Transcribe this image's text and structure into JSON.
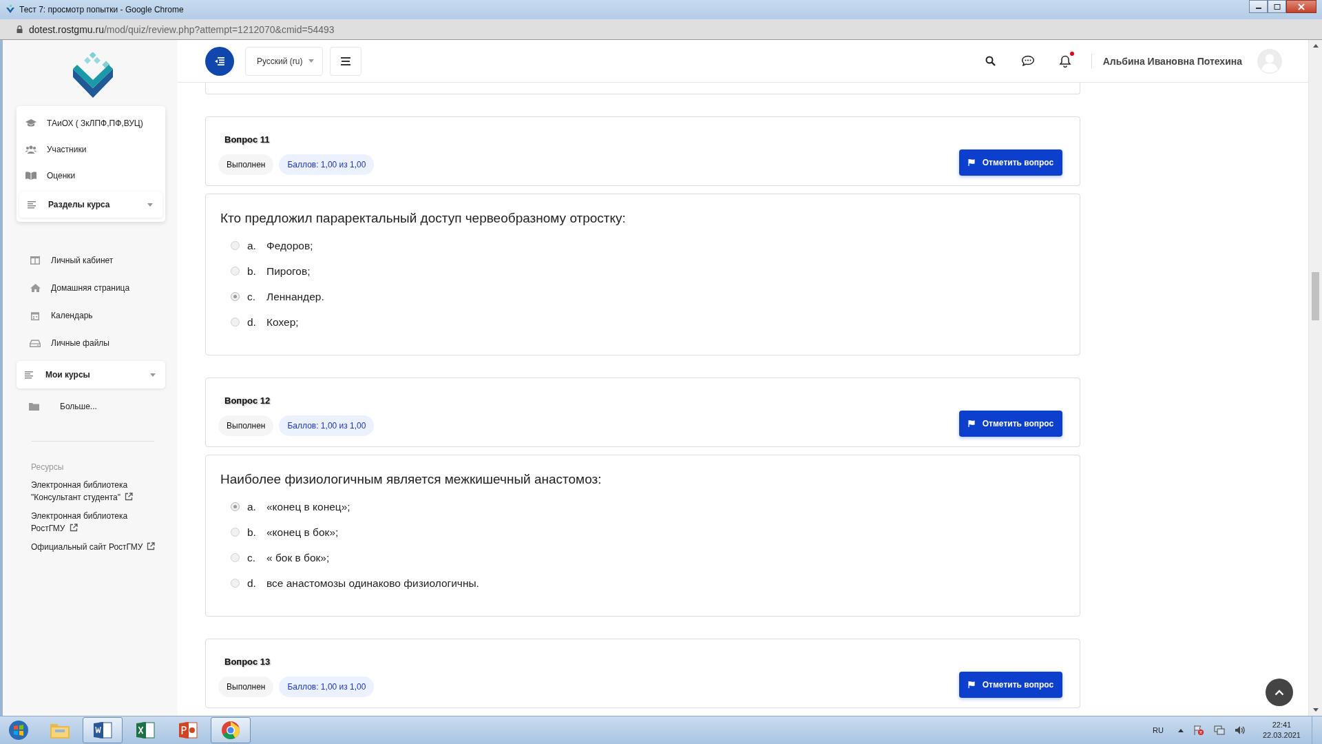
{
  "window": {
    "title": "Тест 7: просмотр попытки - Google Chrome"
  },
  "address_bar": {
    "domain": "dotest.rostgmu.ru",
    "path": "/mod/quiz/review.php?attempt=1212070&cmid=54493"
  },
  "header": {
    "language": "Русский (ru)",
    "has_unread_notifications": true,
    "user_name": "Альбина Ивановна Потехина"
  },
  "sidebar": {
    "course_items": [
      {
        "kind": "course",
        "label": "ТАиОХ ( ЗкЛПФ,ПФ,ВУЦ)"
      },
      {
        "kind": "participants",
        "label": "Участники"
      },
      {
        "kind": "grades",
        "label": "Оценки"
      }
    ],
    "course_sections": {
      "label": "Разделы курса",
      "expanded": false
    },
    "nav_items": [
      {
        "kind": "dashboard",
        "label": "Личный кабинет"
      },
      {
        "kind": "home",
        "label": "Домашняя страница"
      },
      {
        "kind": "calendar",
        "label": "Календарь"
      },
      {
        "kind": "files",
        "label": "Личные файлы"
      }
    ],
    "my_courses": {
      "label": "Мои курсы",
      "expanded": false
    },
    "more": "Больше...",
    "resources_heading": "Ресурсы",
    "resources": [
      {
        "lines": [
          "Электронная библиотека",
          "\"Консультант студента\""
        ]
      },
      {
        "lines": [
          "Электронная библиотека",
          "РостГМУ"
        ]
      },
      {
        "lines": [
          "Официальный сайт РостГМУ"
        ]
      }
    ]
  },
  "questions": [
    {
      "title": "Вопрос 11",
      "state": "Выполнен",
      "grade": "Баллов: 1,00 из 1,00",
      "flag_button": "Отметить вопрос",
      "text": "Кто предложил параректальный доступ червеобразному отростку:",
      "options": [
        {
          "letter": "a.",
          "text": "Федоров;",
          "selected": false
        },
        {
          "letter": "b.",
          "text": "Пирогов;",
          "selected": false
        },
        {
          "letter": "c.",
          "text": "Леннандер.",
          "selected": true
        },
        {
          "letter": "d.",
          "text": "Кохер;",
          "selected": false
        }
      ]
    },
    {
      "title": "Вопрос 12",
      "state": "Выполнен",
      "grade": "Баллов: 1,00 из 1,00",
      "flag_button": "Отметить вопрос",
      "text": "Наиболее физиологичным является межкишечный анастомоз:",
      "options": [
        {
          "letter": "a.",
          "text": "«конец в конец»;",
          "selected": true
        },
        {
          "letter": "b.",
          "text": "«конец в бок»;",
          "selected": false
        },
        {
          "letter": "c.",
          "text": "« бок в бок»;",
          "selected": false
        },
        {
          "letter": "d.",
          "text": "все анастомозы одинаково физиологичны.",
          "selected": false
        }
      ]
    },
    {
      "title": "Вопрос 13",
      "state": "Выполнен",
      "grade": "Баллов: 1,00 из 1,00",
      "flag_button": "Отметить вопрос"
    }
  ],
  "taskbar": {
    "apps": [
      {
        "kind": "explorer",
        "running": false
      },
      {
        "kind": "word",
        "running": true
      },
      {
        "kind": "excel",
        "running": false
      },
      {
        "kind": "powerpoint",
        "running": false
      },
      {
        "kind": "chrome",
        "running": true
      }
    ],
    "language": "RU",
    "time": "22:41",
    "date": "22.03.2021"
  }
}
